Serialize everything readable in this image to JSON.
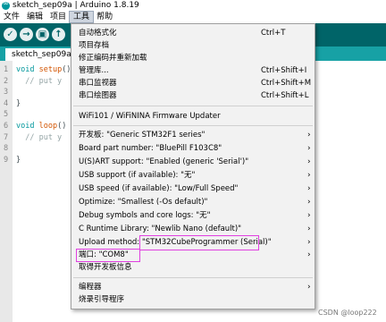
{
  "window": {
    "title": "sketch_sep09a | Arduino 1.8.19"
  },
  "menubar": {
    "items": [
      "文件",
      "编辑",
      "项目",
      "工具",
      "帮助"
    ]
  },
  "toolbar": {
    "verify": "✓",
    "upload": "→",
    "new": "▣",
    "open": "↑"
  },
  "tab": {
    "label": "sketch_sep09a"
  },
  "editor": {
    "lines": [
      {
        "n": "1",
        "parts": [
          [
            "kw",
            "void "
          ],
          [
            "fn",
            "setup"
          ],
          [
            "",
            "()"
          ]
        ]
      },
      {
        "n": "2",
        "parts": [
          [
            "cm",
            "  // put y"
          ]
        ]
      },
      {
        "n": "3",
        "parts": []
      },
      {
        "n": "4",
        "parts": [
          [
            "",
            "}"
          ]
        ]
      },
      {
        "n": "5",
        "parts": []
      },
      {
        "n": "6",
        "parts": [
          [
            "kw",
            "void "
          ],
          [
            "fn",
            "loop"
          ],
          [
            "",
            "()"
          ]
        ]
      },
      {
        "n": "7",
        "parts": [
          [
            "cm",
            "  // put y"
          ]
        ]
      },
      {
        "n": "8",
        "parts": []
      },
      {
        "n": "9",
        "parts": [
          [
            "",
            "}"
          ]
        ]
      }
    ]
  },
  "tools_menu": {
    "items": [
      {
        "label": "自动格式化",
        "shortcut": "Ctrl+T",
        "arrow": ""
      },
      {
        "label": "项目存档",
        "shortcut": "",
        "arrow": ""
      },
      {
        "label": "修正编码并重新加载",
        "shortcut": "",
        "arrow": ""
      },
      {
        "label": "管理库...",
        "shortcut": "Ctrl+Shift+I",
        "arrow": ""
      },
      {
        "label": "串口监视器",
        "shortcut": "Ctrl+Shift+M",
        "arrow": ""
      },
      {
        "label": "串口绘图器",
        "shortcut": "Ctrl+Shift+L",
        "arrow": ""
      },
      {
        "label": "WiFi101 / WiFiNINA Firmware Updater",
        "shortcut": "",
        "arrow": ""
      },
      {
        "label": "开发板: \"Generic STM32F1 series\"",
        "shortcut": "",
        "arrow": "›"
      },
      {
        "label": "Board part number: \"BluePill F103C8\"",
        "shortcut": "",
        "arrow": "›"
      },
      {
        "label": "U(S)ART support: \"Enabled (generic 'Serial')\"",
        "shortcut": "",
        "arrow": "›"
      },
      {
        "label": "USB support (if available): \"无\"",
        "shortcut": "",
        "arrow": "›"
      },
      {
        "label": "USB speed (if available): \"Low/Full Speed\"",
        "shortcut": "",
        "arrow": "›"
      },
      {
        "label": "Optimize: \"Smallest (-Os default)\"",
        "shortcut": "",
        "arrow": "›"
      },
      {
        "label": "Debug symbols and core logs: \"无\"",
        "shortcut": "",
        "arrow": "›"
      },
      {
        "label": "C Runtime Library: \"Newlib Nano (default)\"",
        "shortcut": "",
        "arrow": "›"
      },
      {
        "label": "Upload method: \"STM32CubeProgrammer (Serial)\"",
        "shortcut": "",
        "arrow": "›"
      },
      {
        "label": "端口: \"COM8\"",
        "shortcut": "",
        "arrow": "›"
      },
      {
        "label": "取得开发板信息",
        "shortcut": "",
        "arrow": ""
      },
      {
        "label": "编程器",
        "shortcut": "",
        "arrow": "›"
      },
      {
        "label": "烧录引导程序",
        "shortcut": "",
        "arrow": ""
      }
    ]
  },
  "watermark": "CSDN @loop222",
  "colors": {
    "toolbar": "#006468",
    "tabbar": "#17a1a5",
    "menu_bg": "#f2f2f2",
    "highlight": "#e040e0"
  }
}
